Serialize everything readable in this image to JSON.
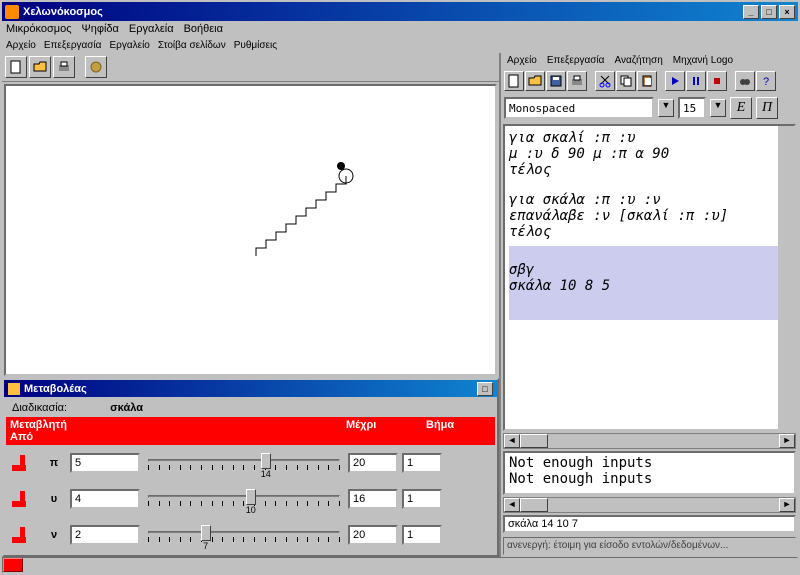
{
  "window": {
    "title": "Χελωνόκοσμος"
  },
  "menubar": {
    "items": [
      "Μικρόκοσμος",
      "Ψηφίδα",
      "Εργαλεία",
      "Βοήθεια"
    ]
  },
  "menubar2": {
    "items": [
      "Αρχείο",
      "Επεξεργασία",
      "Εργαλείο",
      "Στοίβα σελίδων",
      "Ρυθμίσεις"
    ]
  },
  "right_menu": {
    "items": [
      "Αρχείο",
      "Επεξεργασία",
      "Αναζήτηση",
      "Μηχανή Logo"
    ]
  },
  "font": {
    "name": "Monospaced",
    "size": "15",
    "btn1": "E",
    "btn2": "Π"
  },
  "code": {
    "l1": "για σκαλί :π :υ",
    "l2": "μ :υ δ 90 μ :π α 90",
    "l3": "τέλος",
    "l4": "για σκάλα :π :υ :ν",
    "l5": "επανάλαβε :ν [σκαλί :π :υ]",
    "l6": "τέλος",
    "c1": "σβγ",
    "c2": "σκάλα 10 8 5"
  },
  "errors": {
    "e1": "Not enough inputs",
    "e2": "Not enough inputs"
  },
  "cmd_input": "σκάλα 14 10 7",
  "status": "ανενεργή: έτοιμη για είσοδο εντολών/δεδομένων...",
  "sliders": {
    "title": "Μεταβολέας",
    "proc_label": "Διαδικασία:",
    "proc_name": "σκάλα",
    "headers": {
      "var": "Μεταβλητή",
      "from": "Από",
      "to": "Μέχρι",
      "step": "Βήμα"
    },
    "rows": [
      {
        "name": "π",
        "from": "5",
        "to": "20",
        "step": "1",
        "pos": 0.6,
        "lbl": "14"
      },
      {
        "name": "υ",
        "from": "4",
        "to": "16",
        "step": "1",
        "pos": 0.52,
        "lbl": "10"
      },
      {
        "name": "ν",
        "from": "2",
        "to": "20",
        "step": "1",
        "pos": 0.28,
        "lbl": "7"
      }
    ]
  },
  "win_btns": {
    "min": "_",
    "max": "□",
    "close": "×"
  }
}
